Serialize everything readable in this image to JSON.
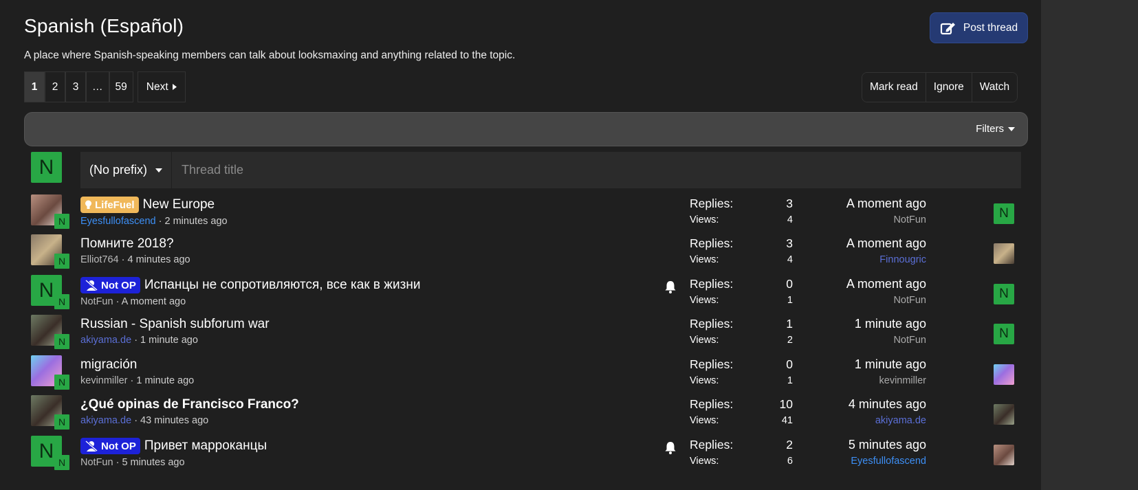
{
  "forum": {
    "title": "Spanish (Español)",
    "description": "A place where Spanish-speaking members can talk about looksmaxing and anything related to the topic.",
    "post_thread_label": "Post thread"
  },
  "pagination": {
    "pages": [
      "1",
      "2",
      "3",
      "…",
      "59"
    ],
    "current": "1",
    "next_label": "Next"
  },
  "actions": {
    "mark_read": "Mark read",
    "ignore": "Ignore",
    "watch": "Watch"
  },
  "filters": {
    "label": "Filters"
  },
  "new_thread": {
    "avatar_letter": "N",
    "prefix_label": "(No prefix)",
    "title_placeholder": "Thread title"
  },
  "stat_labels": {
    "replies": "Replies:",
    "views": "Views:"
  },
  "threads": [
    {
      "label": "LifeFuel",
      "title": "New Europe",
      "author": "Eyesfullofascend",
      "age": "2 minutes ago",
      "replies": "3",
      "views": "4",
      "last_time": "A moment ago",
      "last_user": "NotFun"
    },
    {
      "label": "",
      "title": "Помните 2018?",
      "author": "Elliot764",
      "age": "4 minutes ago",
      "replies": "3",
      "views": "4",
      "last_time": "A moment ago",
      "last_user": "Finnougric"
    },
    {
      "label": "Not OP",
      "title": "Испанцы не сопротивляются, все как в жизни",
      "author": "NotFun",
      "age": "A moment ago",
      "replies": "0",
      "views": "1",
      "last_time": "A moment ago",
      "last_user": "NotFun"
    },
    {
      "label": "",
      "title": "Russian - Spanish subforum war",
      "author": "akiyama.de",
      "age": "1 minute ago",
      "replies": "1",
      "views": "2",
      "last_time": "1 minute ago",
      "last_user": "NotFun"
    },
    {
      "label": "",
      "title": "migración",
      "author": "kevinmiller",
      "age": "1 minute ago",
      "replies": "0",
      "views": "1",
      "last_time": "1 minute ago",
      "last_user": "kevinmiller"
    },
    {
      "label": "",
      "title": "¿Qué opinas de Francisco Franco?",
      "author": "akiyama.de",
      "age": "43 minutes ago",
      "replies": "10",
      "views": "41",
      "last_time": "4 minutes ago",
      "last_user": "akiyama.de"
    },
    {
      "label": "Not OP",
      "title": "Привет марроканцы",
      "author": "NotFun",
      "age": "5 minutes ago",
      "replies": "2",
      "views": "6",
      "last_time": "5 minutes ago",
      "last_user": "Eyesfullofascend"
    }
  ],
  "avatar_letter": "N",
  "colors": {
    "background": "#1f1f1f",
    "post_button": "#253a73",
    "avatar_green": "#28a745",
    "lifefuel_label": "#f0b85a",
    "notop_label": "#1d22d8",
    "username_blue": "#3d8ff5"
  }
}
